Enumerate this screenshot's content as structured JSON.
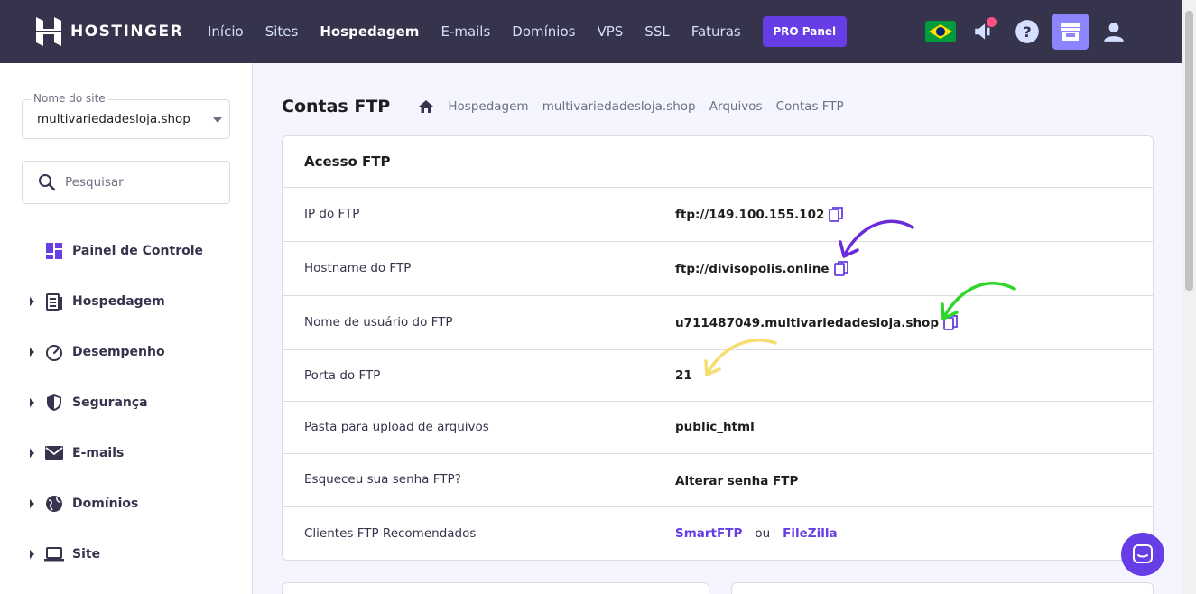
{
  "topbar": {
    "brand": "HOSTINGER",
    "nav": [
      {
        "label": "Início",
        "active": false
      },
      {
        "label": "Sites",
        "active": false
      },
      {
        "label": "Hospedagem",
        "active": true
      },
      {
        "label": "E-mails",
        "active": false
      },
      {
        "label": "Domínios",
        "active": false
      },
      {
        "label": "VPS",
        "active": false
      },
      {
        "label": "SSL",
        "active": false
      },
      {
        "label": "Faturas",
        "active": false
      }
    ],
    "pro_button": "PRO Panel",
    "icons": [
      "brazil-flag-icon",
      "announcement-icon",
      "help-icon",
      "store-icon",
      "user-icon"
    ]
  },
  "sidebar": {
    "site_select": {
      "label": "Nome do site",
      "value": "multivariedadesloja.shop"
    },
    "search": {
      "placeholder": "Pesquisar"
    },
    "items": [
      {
        "label": "Painel de Controle",
        "icon": "dashboard-icon",
        "expandable": false
      },
      {
        "label": "Hospedagem",
        "icon": "hosting-icon",
        "expandable": true
      },
      {
        "label": "Desempenho",
        "icon": "speedometer-icon",
        "expandable": true
      },
      {
        "label": "Segurança",
        "icon": "shield-icon",
        "expandable": true
      },
      {
        "label": "E-mails",
        "icon": "mail-icon",
        "expandable": true
      },
      {
        "label": "Domínios",
        "icon": "globe-icon",
        "expandable": true
      },
      {
        "label": "Site",
        "icon": "laptop-icon",
        "expandable": true
      }
    ]
  },
  "main": {
    "title": "Contas FTP",
    "breadcrumb": [
      "- Hospedagem",
      "- multivariedadesloja.shop",
      "- Arquivos",
      "- Contas FTP"
    ],
    "card": {
      "title": "Acesso FTP",
      "rows": [
        {
          "label": "IP do FTP",
          "value": "ftp://149.100.155.102"
        },
        {
          "label": "Hostname do FTP",
          "value": "ftp://divisopolis.online"
        },
        {
          "label": "Nome de usuário do FTP",
          "value": "u711487049.multivariedadesloja.shop"
        },
        {
          "label": "Porta do FTP",
          "value": "21"
        },
        {
          "label": "Pasta para upload de arquivos",
          "value": "public_html"
        },
        {
          "label": "Esqueceu sua senha FTP?",
          "value": "Alterar senha FTP"
        },
        {
          "label": "Clientes FTP Recomendados",
          "value": "SmartFTP",
          "separator": "ou",
          "value2": "FileZilla"
        }
      ]
    }
  },
  "annotations": {
    "arrow_colors": [
      "#6a2bd9",
      "#2fd62a",
      "#f7dc6f"
    ]
  },
  "colors": {
    "topbar": "#36344d",
    "accent": "#673de6",
    "background": "#f4f5ff"
  }
}
